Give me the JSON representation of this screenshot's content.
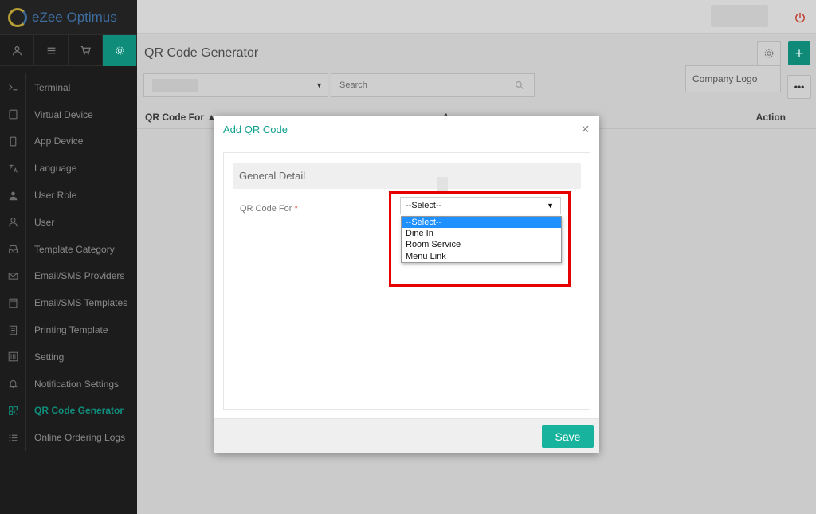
{
  "app": {
    "name": "eZee Optimus"
  },
  "sidebar": {
    "menu": [
      {
        "label": "Terminal",
        "icon": "terminal-icon"
      },
      {
        "label": "Virtual Device",
        "icon": "tablet-icon"
      },
      {
        "label": "App Device",
        "icon": "mobile-icon"
      },
      {
        "label": "Language",
        "icon": "language-icon"
      },
      {
        "label": "User Role",
        "icon": "user-role-icon"
      },
      {
        "label": "User",
        "icon": "user-icon"
      },
      {
        "label": "Template Category",
        "icon": "inbox-icon"
      },
      {
        "label": "Email/SMS Providers",
        "icon": "envelope-icon"
      },
      {
        "label": "Email/SMS Templates",
        "icon": "template-icon"
      },
      {
        "label": "Printing Template",
        "icon": "document-icon"
      },
      {
        "label": "Setting",
        "icon": "setting-icon"
      },
      {
        "label": "Notification Settings",
        "icon": "bell-icon"
      },
      {
        "label": "QR Code Generator",
        "icon": "qr-icon",
        "active": true
      },
      {
        "label": "Online Ordering Logs",
        "icon": "list-icon"
      }
    ]
  },
  "page": {
    "title": "QR Code Generator",
    "search_placeholder": "Search",
    "company_logo_label": "Company Logo",
    "more_label": "•••",
    "columns": {
      "qr_code_for": "QR Code For ▲",
      "action_partial": "A...",
      "action": "Action"
    }
  },
  "modal": {
    "title": "Add QR Code",
    "close_label": "×",
    "section_title": "General Detail",
    "field_label": "QR Code For",
    "required_mark": "*",
    "selected_value": "--Select--",
    "options": [
      "--Select--",
      "Dine In",
      "Room Service",
      "Menu Link"
    ],
    "save_label": "Save"
  },
  "colors": {
    "accent": "#12a08e",
    "highlight": "#e60000",
    "sidebar_bg": "#1c1c1c"
  }
}
